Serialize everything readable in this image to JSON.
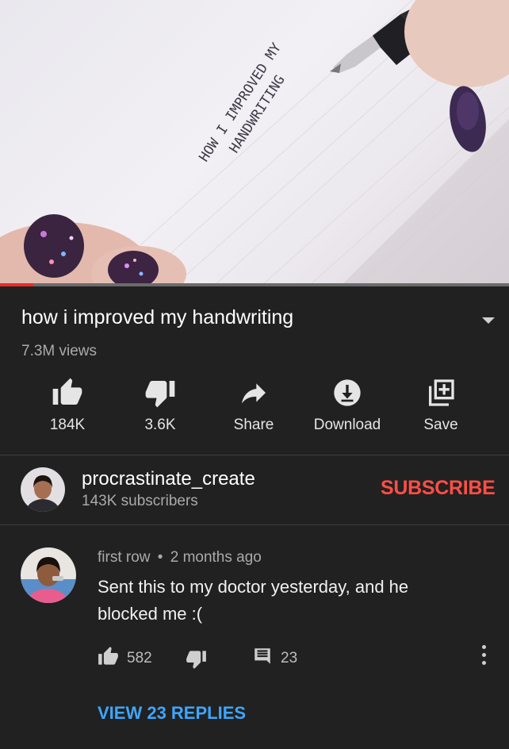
{
  "video": {
    "handwriting_line1": "HOW I IMPROVED MY",
    "handwriting_line2": "HANDWRITING",
    "progress_percent": 6.5,
    "progress_color": "#e52d27"
  },
  "title": "how i improved my handwriting",
  "views": "7.3M views",
  "actions": [
    {
      "icon": "thumb-up-icon",
      "label": "184K"
    },
    {
      "icon": "thumb-down-icon",
      "label": "3.6K"
    },
    {
      "icon": "share-icon",
      "label": "Share"
    },
    {
      "icon": "download-icon",
      "label": "Download"
    },
    {
      "icon": "save-icon",
      "label": "Save"
    }
  ],
  "channel": {
    "name": "procrastinate_create",
    "subscribers": "143K subscribers",
    "subscribe_label": "SUBSCRIBE",
    "subscribe_color": "#ff4e45"
  },
  "comment": {
    "author": "first row",
    "separator": "•",
    "time": "2 months ago",
    "text": "Sent this to my doctor yesterday, and he blocked me :(",
    "likes": "582",
    "reply_count": "23",
    "view_replies_label": "VIEW 23 REPLIES",
    "link_color": "#3ea6ff"
  }
}
